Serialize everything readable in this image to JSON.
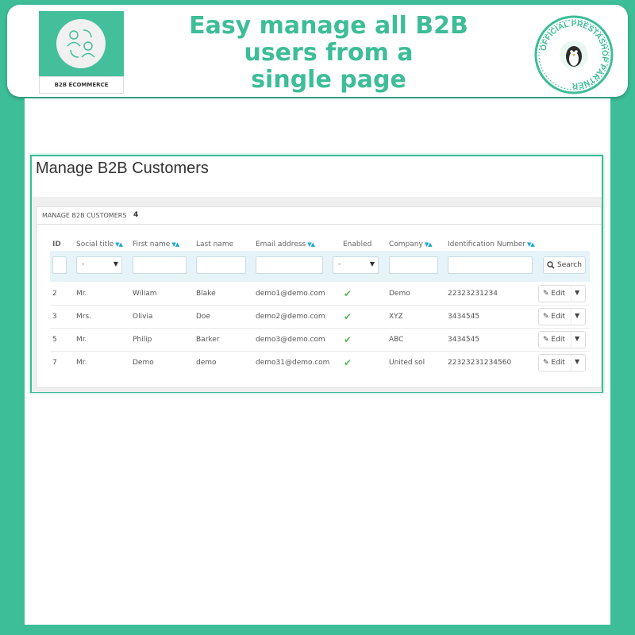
{
  "banner": {
    "headline_line1": "Easy manage all B2B",
    "headline_line2": "users from a",
    "headline_line3": "single page",
    "logo_label": "B2B ECOMMERCE",
    "seal_text": "OFFICIAL PRESTASHOP PARTNER"
  },
  "panel": {
    "title": "Manage B2B Customers",
    "tab_label": "MANAGE B2B CUSTOMERS",
    "count": "4"
  },
  "table": {
    "headers": {
      "id": "ID",
      "social_title": "Social title",
      "first_name": "First name",
      "last_name": "Last name",
      "email": "Email address",
      "enabled": "Enabled",
      "company": "Company",
      "identification": "Identification Number"
    },
    "filters": {
      "social_title_value": "-",
      "enabled_value": "-",
      "search_label": "Search"
    },
    "edit_label": "Edit",
    "rows": [
      {
        "id": "2",
        "social_title": "Mr.",
        "first_name": "Wiliam",
        "last_name": "Blake",
        "email": "demo1@demo.com",
        "enabled": "✔",
        "company": "Demo",
        "identification": "22323231234"
      },
      {
        "id": "3",
        "social_title": "Mrs.",
        "first_name": "Olivia",
        "last_name": "Doe",
        "email": "demo2@demo.com",
        "enabled": "✔",
        "company": "XYZ",
        "identification": "3434545"
      },
      {
        "id": "5",
        "social_title": "Mr.",
        "first_name": "Philip",
        "last_name": "Barker",
        "email": "demo3@demo.com",
        "enabled": "✔",
        "company": "ABC",
        "identification": "3434545"
      },
      {
        "id": "7",
        "social_title": "Mr.",
        "first_name": "Demo",
        "last_name": "demo",
        "email": "demo31@demo.com",
        "enabled": "✔",
        "company": "United sol",
        "identification": "22323231234560"
      }
    ]
  },
  "colors": {
    "brand_green": "#3dbd98",
    "sort_blue": "#1ea7d4",
    "enabled_green": "#5cb85c"
  }
}
